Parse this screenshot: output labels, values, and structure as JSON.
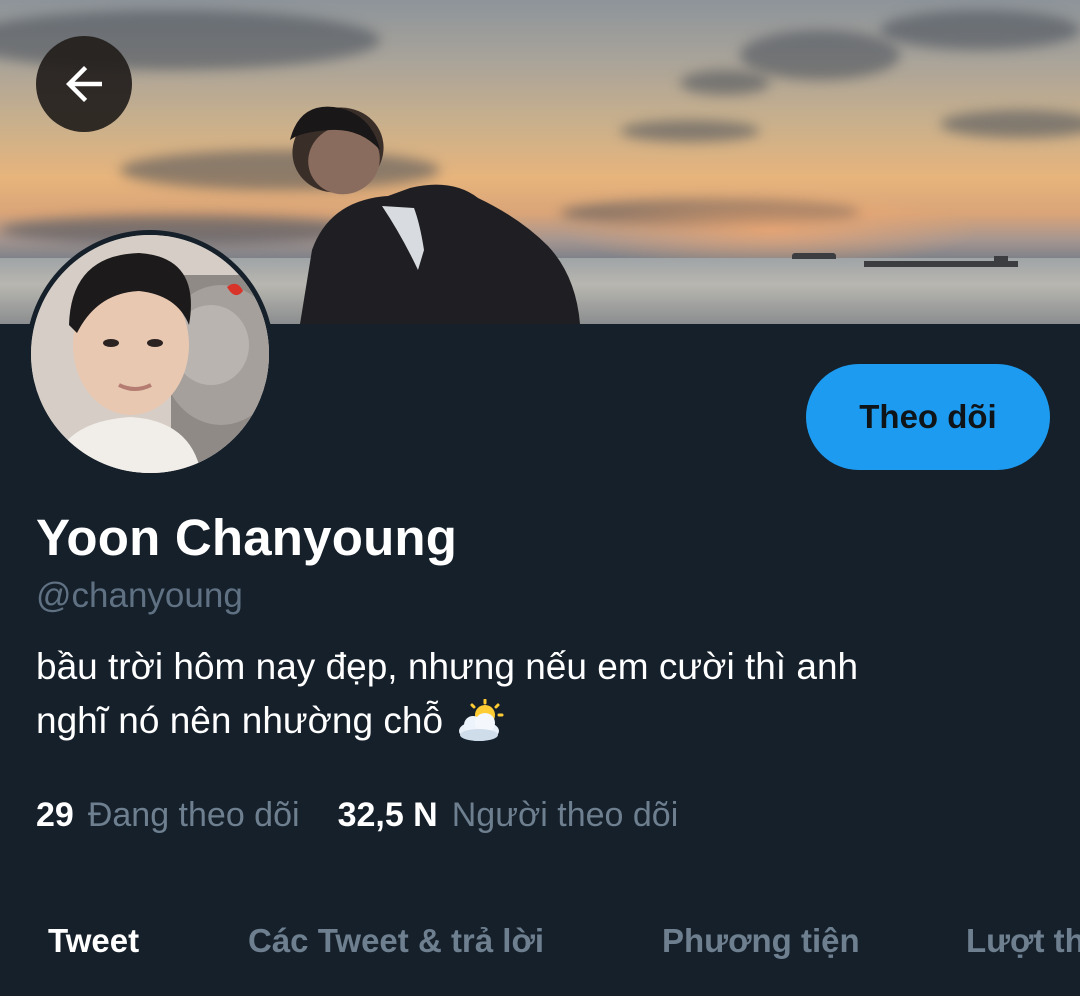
{
  "header": {
    "back_icon": "arrow-left-icon",
    "banner_image": "sunset-beach-photo",
    "avatar_image": "profile-photo"
  },
  "profile": {
    "display_name": "Yoon Chanyoung",
    "handle": "@chanyoung",
    "bio_line1": "bầu trời hôm nay đẹp, nhưng nếu em cười thì anh",
    "bio_line2": "nghĩ nó nên nhường chỗ",
    "bio_emoji": "sun-behind-cloud-icon",
    "follow_label": "Theo dõi"
  },
  "stats": {
    "following_count": "29",
    "following_label": "Đang theo dõi",
    "followers_count": "32,5 N",
    "followers_label": "Người theo dõi"
  },
  "tabs": [
    {
      "label": "Tweet",
      "active": true
    },
    {
      "label": "Các Tweet & trả lời",
      "active": false
    },
    {
      "label": "Phương tiện",
      "active": false
    },
    {
      "label": "Lượt thích",
      "active": false
    }
  ],
  "colors": {
    "background": "#15202b",
    "accent": "#1d9bf0",
    "text_primary": "#ffffff",
    "text_secondary": "#6e7f8f"
  }
}
